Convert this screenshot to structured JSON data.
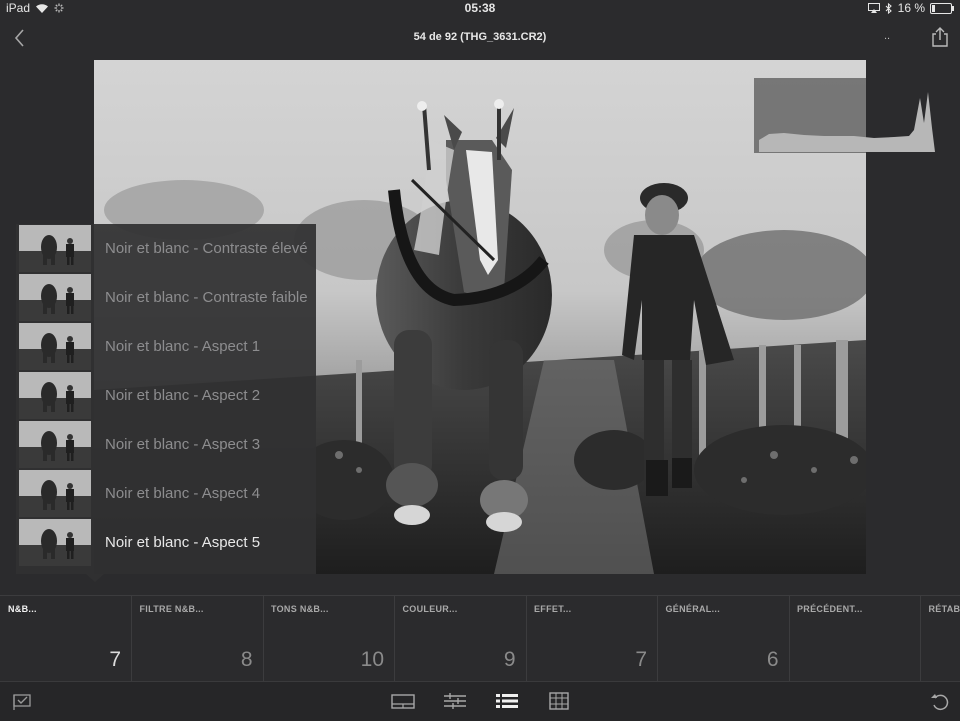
{
  "status_bar": {
    "device": "iPad",
    "time": "05:38",
    "battery_percent_label": "16 %",
    "battery_level": 0.16
  },
  "header": {
    "title": "54 de 92 (THG_3631.CR2)",
    "overflow_label": ".."
  },
  "presets": {
    "items": [
      {
        "label": "Noir et blanc - Contraste élevé",
        "selected": false
      },
      {
        "label": "Noir et blanc - Contraste faible",
        "selected": false
      },
      {
        "label": "Noir et blanc - Aspect 1",
        "selected": false
      },
      {
        "label": "Noir et blanc - Aspect 2",
        "selected": false
      },
      {
        "label": "Noir et blanc - Aspect 3",
        "selected": false
      },
      {
        "label": "Noir et blanc - Aspect 4",
        "selected": false
      },
      {
        "label": "Noir et blanc - Aspect 5",
        "selected": true
      }
    ]
  },
  "categories": [
    {
      "label": "N&B...",
      "count": "7",
      "active": true
    },
    {
      "label": "FILTRE N&B...",
      "count": "8",
      "active": false
    },
    {
      "label": "TONS N&B...",
      "count": "10",
      "active": false
    },
    {
      "label": "COULEUR...",
      "count": "9",
      "active": false
    },
    {
      "label": "EFFET...",
      "count": "7",
      "active": false
    },
    {
      "label": "GÉNÉRAL...",
      "count": "6",
      "active": false
    },
    {
      "label": "PRÉCÉDENT...",
      "count": "",
      "active": false
    },
    {
      "label": "RÉTAB",
      "count": "",
      "active": false
    }
  ],
  "toolbar": {
    "icons": [
      "flag-icon",
      "filmstrip-icon",
      "adjust-sliders-icon",
      "presets-list-icon",
      "crop-icon",
      "undo-icon"
    ],
    "active": "presets-list-icon"
  },
  "colors": {
    "background": "#2b2b2d",
    "panel": "#303032",
    "text_active": "#e8e8e8",
    "text_dim": "#8d8d8f"
  }
}
